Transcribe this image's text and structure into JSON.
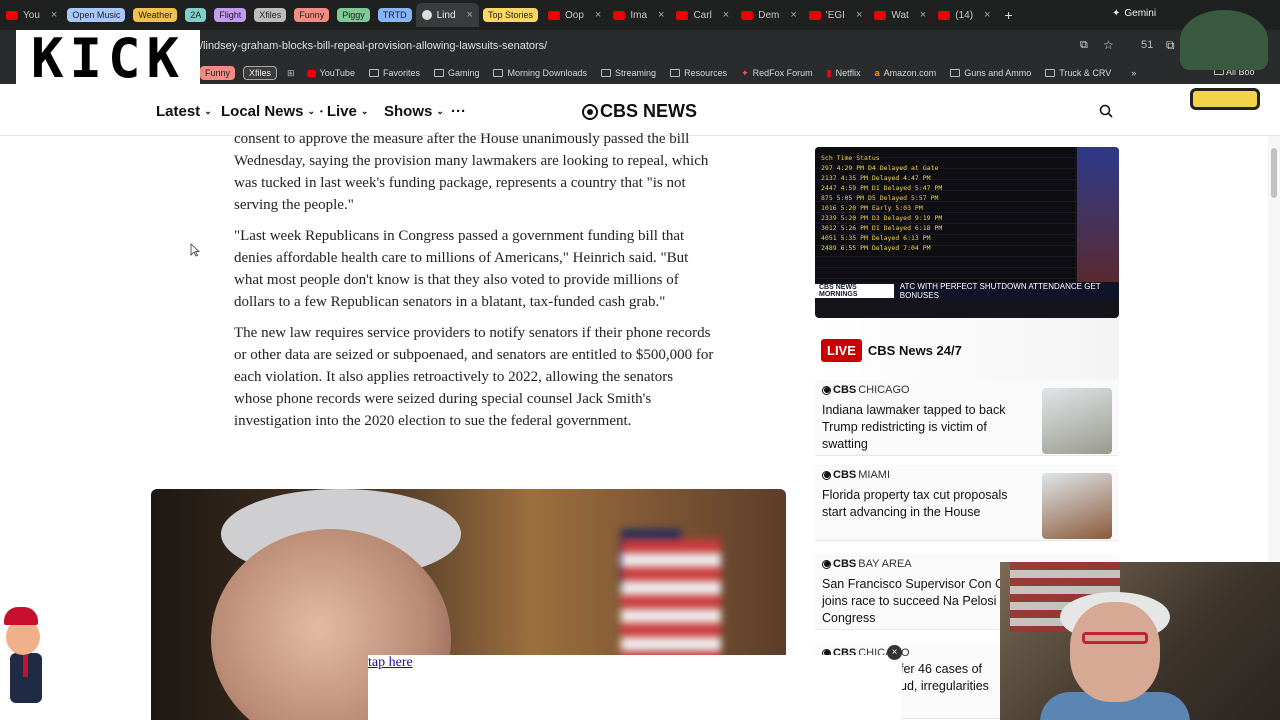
{
  "browser": {
    "tabs": [
      {
        "label": "You",
        "type": "tab"
      },
      {
        "label": "Open Music",
        "type": "pill",
        "color": "#a8c7fa"
      },
      {
        "label": "Weather",
        "type": "pill",
        "color": "#f2c14e"
      },
      {
        "label": "2A",
        "type": "pill",
        "color": "#7ed0c8"
      },
      {
        "label": "Flight",
        "type": "pill",
        "color": "#c39bf0"
      },
      {
        "label": "Xfiles",
        "type": "pill",
        "color": "#bdbdbd"
      },
      {
        "label": "Funny",
        "type": "pill",
        "color": "#f28b82"
      },
      {
        "label": "Piggy",
        "type": "pill",
        "color": "#81c995"
      },
      {
        "label": "TRTD",
        "type": "pill",
        "color": "#8ab4f8"
      },
      {
        "label": "Lind",
        "type": "tab",
        "active": true
      },
      {
        "label": "Top Stories",
        "type": "pill",
        "color": "#fdd663"
      },
      {
        "label": "Oop",
        "type": "tab"
      },
      {
        "label": "Ima",
        "type": "tab"
      },
      {
        "label": "Carl",
        "type": "tab"
      },
      {
        "label": "Dem",
        "type": "tab"
      },
      {
        "label": "'EGI",
        "type": "tab"
      },
      {
        "label": "Wat",
        "type": "tab"
      },
      {
        "label": "(14)",
        "type": "tab"
      }
    ],
    "new_tab": "+",
    "gemini": "Gemini",
    "url": "/lindsey-graham-blocks-bill-repeal-provision-allowing-lawsuits-senators/",
    "counter": "51",
    "bookmarks": [
      "Funny",
      "Xfiles",
      "YouTube",
      "Favorites",
      "Gaming",
      "Morning Downloads",
      "Streaming",
      "Resources",
      "RedFox Forum",
      "Netflix",
      "Amazon.com",
      "Guns and Ammo",
      "Truck & CRV"
    ],
    "more_bookmarks": "»",
    "all_bookmarks": "All Boo",
    "overlay_logo": "KICK"
  },
  "site": {
    "nav": [
      "Latest",
      "Local News",
      "Live",
      "Shows"
    ],
    "more": "···",
    "logo": "CBS NEWS"
  },
  "article": {
    "paragraphs": [
      "consent to approve the measure after the House unanimously passed the bill Wednesday, saying the provision many lawmakers are looking to repeal, which was tucked in last week's funding package, represents a country that \"is not serving the people.\"",
      "\"Last week Republicans in Congress passed a government funding bill that denies affordable health care to millions of Americans,\" Heinrich said. \"But what most people don't know is that they also voted to provide millions of dollars to a few Republican senators in a blatant, tax-funded cash grab.\"",
      "The new law requires service providers to notify senators if their phone records or other data are seized or subpoenaed, and senators are entitled to $500,000 for each violation. It also applies retroactively to 2022, allowing the senators whose phone records were seized during special counsel Jack Smith's investigation into the 2020 election to sue the federal government."
    ]
  },
  "sidebar": {
    "video_ticker_logo": "CBS NEWS MORNINGS",
    "video_ticker": "ATC WITH PERFECT SHUTDOWN ATTENDANCE GET BONUSES",
    "board_header": "Sch Time   Status",
    "board_rows": [
      "297  4:29 PM D4  Delayed at Gate",
      "2137 4:35 PM     Delayed 4:47 PM",
      "2447 4:59 PM D1  Delayed 5:47 PM",
      "875  5:05 PM D5  Delayed 5:57 PM",
      "1016 5:20 PM     Early 5:03 PM",
      "2339 5:20 PM D3  Delayed 9:19 PM",
      "3012 5:26 PM D1  Delayed 6:18 PM",
      "4051 5:35 PM     Delayed 6:13 PM",
      "2489 6:55 PM     Delayed 7:04 PM"
    ],
    "live_badge": "LIVE",
    "live_title": "CBS News 24/7",
    "cards": [
      {
        "brand": "CBS",
        "market": "CHICAGO",
        "title": "Indiana lawmaker tapped to back Trump redistricting is victim of swatting",
        "thumb": "#9a9a8c"
      },
      {
        "brand": "CBS",
        "market": "MIAMI",
        "title": "Florida property tax cut proposals start advancing in the House",
        "thumb": "#8a5a3a"
      },
      {
        "brand": "CBS",
        "market": "BAY AREA",
        "title": "San Francisco Supervisor Con Chan joins race to succeed Na Pelosi in Congress",
        "thumb": "#6a6a6a"
      },
      {
        "brand": "CBS",
        "market": "CHICAGO",
        "title": "fer 46 cases of ud, irregularities",
        "thumb": "#7a7a7a"
      }
    ]
  },
  "ad": {
    "link": "tap here",
    "close": "×"
  }
}
